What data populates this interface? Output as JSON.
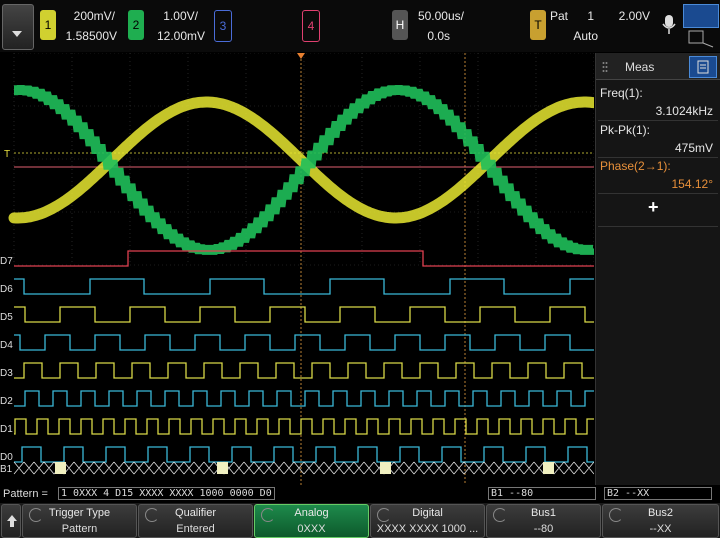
{
  "top": {
    "ch1": {
      "num": "1",
      "scale": "200mV/",
      "offset": "1.58500V",
      "color": "#e8e830"
    },
    "ch2": {
      "num": "2",
      "scale": "1.00V/",
      "offset": "12.00mV",
      "color": "#1fbf5a"
    },
    "ch3": {
      "num": "3",
      "color": "#4a6cd8"
    },
    "ch4": {
      "num": "4",
      "color": "#e04070"
    },
    "horiz": {
      "label": "H",
      "scale": "50.00us/",
      "delay": "0.0s"
    },
    "trigger": {
      "label": "T",
      "type": "Pat",
      "source": "1",
      "level": "2.00V",
      "mode": "Auto"
    }
  },
  "meas": {
    "title": "Meas",
    "items": [
      {
        "label": "Freq(1):",
        "value": "3.1024kHz",
        "color": "#e6e6e6"
      },
      {
        "label": "Pk-Pk(1):",
        "value": "475mV",
        "color": "#e6e6e6"
      },
      {
        "label": "Phase(2→1):",
        "value": "154.12°",
        "color": "#e8903a"
      }
    ],
    "add_label": "+"
  },
  "digital_labels": [
    "D7",
    "D6",
    "D5",
    "D4",
    "D3",
    "D2",
    "D1",
    "D0"
  ],
  "bus_label": "B1",
  "pattern": {
    "label": "Pattern =",
    "value": "1 0XXX 4 D15 XXXX XXXX 1000 0000 D0",
    "b1": "B1 --80",
    "b2": "B2 --XX"
  },
  "softkeys": [
    {
      "title": "Trigger Type",
      "value": "Pattern"
    },
    {
      "title": "Qualifier",
      "value": "Entered"
    },
    {
      "title": "Analog",
      "value": "0XXX"
    },
    {
      "title": "Digital",
      "value": "XXXX XXXX 1000 ..."
    },
    {
      "title": "Bus1",
      "value": "--80"
    },
    {
      "title": "Bus2",
      "value": "--XX"
    }
  ],
  "colors": {
    "grid": "#3a3a3a",
    "digital": "#3ab8d8",
    "digital_alt": "#d8d848",
    "d7": "#e04050",
    "trig_line": "#e08040"
  }
}
